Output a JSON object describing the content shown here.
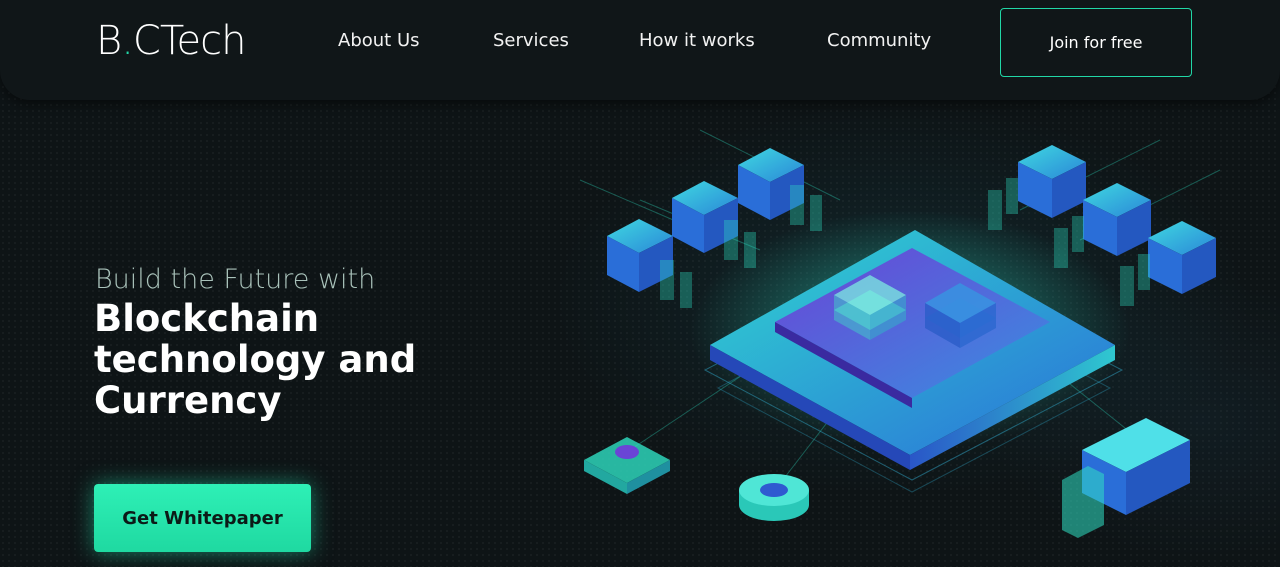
{
  "brand": {
    "name_part1": "B",
    "dot": ".",
    "name_part2": "CTech",
    "accent": "#21d7a6"
  },
  "nav": {
    "items": [
      {
        "label": "About Us"
      },
      {
        "label": "Services"
      },
      {
        "label": "How it works"
      },
      {
        "label": "Community"
      }
    ],
    "join_label": "Join for free"
  },
  "hero": {
    "subtitle": "Build the Future with",
    "title": "Blockchain technology and Currency",
    "cta_label": "Get Whitepaper"
  },
  "illustration": {
    "name": "blockchain-isometric-illustration",
    "colors": {
      "teal": "#2fe0c4",
      "blue": "#2b6fd6",
      "purple": "#6a44d6"
    }
  }
}
